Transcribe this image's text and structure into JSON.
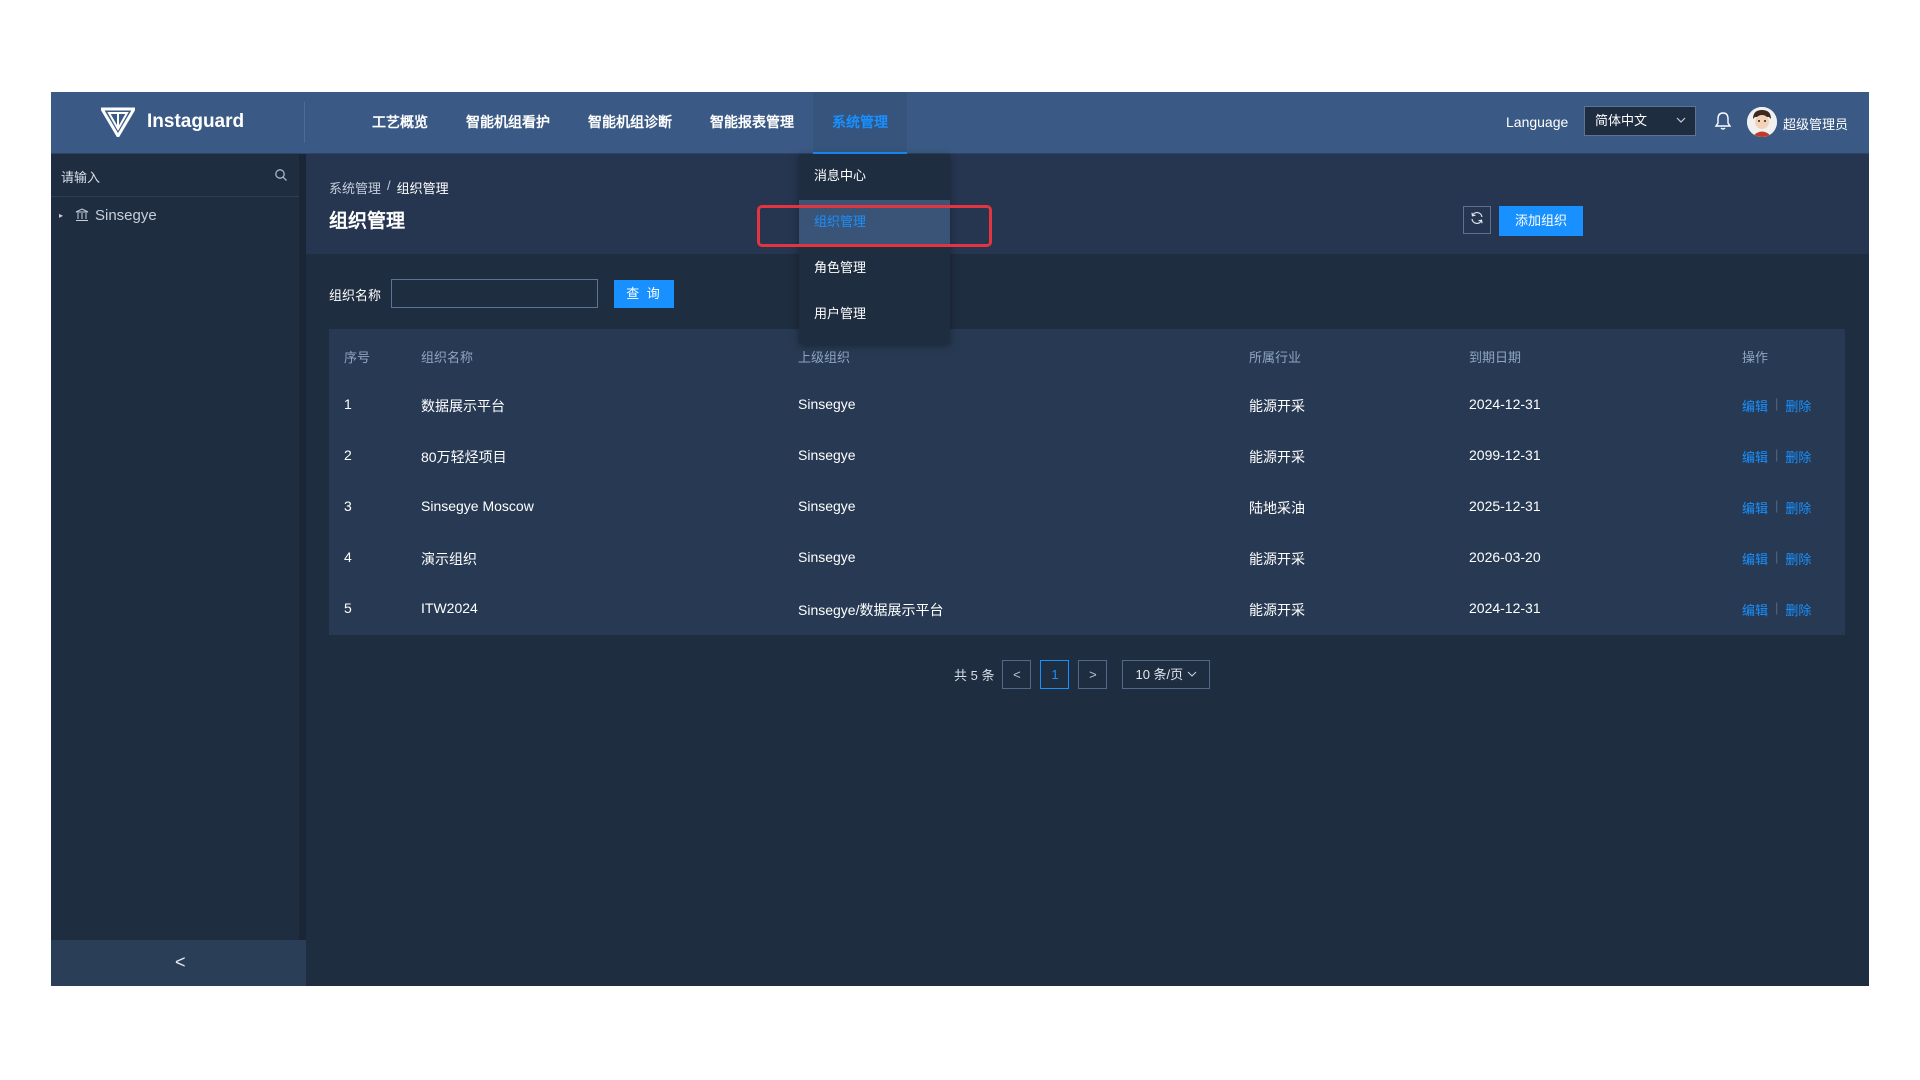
{
  "brand": {
    "name": "Instaguard"
  },
  "nav": {
    "items": [
      {
        "label": "工艺概览"
      },
      {
        "label": "智能机组看护"
      },
      {
        "label": "智能机组诊断"
      },
      {
        "label": "智能报表管理"
      },
      {
        "label": "系统管理"
      }
    ],
    "active": "系统管理"
  },
  "header": {
    "language_label": "Language",
    "language_value": "简体中文",
    "user_name": "超级管理员"
  },
  "sidebar": {
    "search_placeholder": "请输入",
    "tree": [
      {
        "label": "Sinsegye"
      }
    ],
    "collapse_glyph": "<"
  },
  "dropdown": {
    "items": [
      {
        "label": "消息中心"
      },
      {
        "label": "组织管理"
      },
      {
        "label": "角色管理"
      },
      {
        "label": "用户管理"
      }
    ],
    "selected": "组织管理"
  },
  "breadcrumb": {
    "parent": "系统管理",
    "separator": "/",
    "current": "组织管理"
  },
  "page": {
    "title": "组织管理",
    "add_button": "添加组织"
  },
  "filter": {
    "label": "组织名称",
    "value": "",
    "query_button": "查 询"
  },
  "table": {
    "headers": [
      "序号",
      "组织名称",
      "上级组织",
      "所属行业",
      "到期日期",
      "操作"
    ],
    "rows": [
      {
        "no": "1",
        "name": "数据展示平台",
        "parent": "Sinsegye",
        "industry": "能源开采",
        "expiry": "2024-12-31"
      },
      {
        "no": "2",
        "name": "80万轻烃项目",
        "parent": "Sinsegye",
        "industry": "能源开采",
        "expiry": "2099-12-31"
      },
      {
        "no": "3",
        "name": "Sinsegye Moscow",
        "parent": "Sinsegye",
        "industry": "陆地采油",
        "expiry": "2025-12-31"
      },
      {
        "no": "4",
        "name": "演示组织",
        "parent": "Sinsegye",
        "industry": "能源开采",
        "expiry": "2026-03-20"
      },
      {
        "no": "5",
        "name": "ITW2024",
        "parent": "Sinsegye/数据展示平台",
        "industry": "能源开采",
        "expiry": "2024-12-31"
      }
    ],
    "op_edit": "编辑",
    "op_delete": "删除",
    "op_sep": "|"
  },
  "pagination": {
    "total": "共 5 条",
    "prev": "<",
    "current": "1",
    "next": ">",
    "page_size": "10 条/页"
  },
  "colors": {
    "accent": "#1890ff",
    "header": "#3a5a85",
    "background": "#1f2d40",
    "highlight": "#e3343f"
  }
}
